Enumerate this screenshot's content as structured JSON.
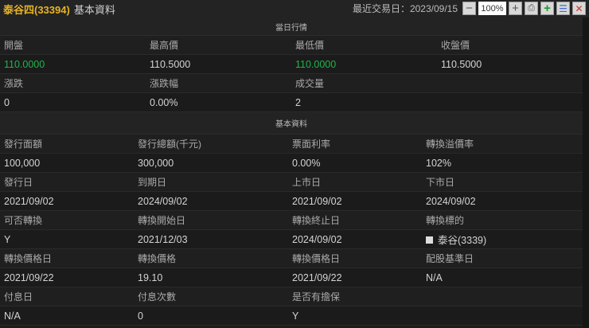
{
  "header": {
    "name": "泰谷四(33394)",
    "subtitle": "基本資料",
    "trade_date": "最近交易日：2023/09/15",
    "zoom": "100%"
  },
  "accent": {
    "title": "#e6b422",
    "green": "#1fb44a"
  },
  "daily": {
    "title": "當日行情",
    "rows": [
      [
        "開盤",
        "最高價",
        "最低價",
        "收盤價"
      ],
      [
        "110.0000",
        "110.5000",
        "110.0000",
        "110.5000"
      ],
      [
        "漲跌",
        "漲跌幅",
        "成交量",
        ""
      ],
      [
        "0",
        "0.00%",
        "2",
        ""
      ]
    ]
  },
  "basic": {
    "title": "基本資料",
    "rows": [
      [
        "發行面額",
        "發行總額(千元)",
        "票面利率",
        "轉換溢價率"
      ],
      [
        "100,000",
        "300,000",
        "0.00%",
        "102%"
      ],
      [
        "發行日",
        "到期日",
        "上市日",
        "下市日"
      ],
      [
        "2021/09/02",
        "2024/09/02",
        "2021/09/02",
        "2024/09/02"
      ],
      [
        "可否轉換",
        "轉換開始日",
        "轉換終止日",
        "轉換標的"
      ],
      [
        "Y",
        "2021/12/03",
        "2024/09/02",
        "泰谷(3339)"
      ],
      [
        "轉換價格日",
        "轉換價格",
        "轉換價格日",
        "配股基準日"
      ],
      [
        "2021/09/22",
        "19.10",
        "2021/09/22",
        "N/A"
      ],
      [
        "付息日",
        "付息次數",
        "是否有擔保",
        ""
      ],
      [
        "N/A",
        "0",
        "Y",
        ""
      ]
    ]
  }
}
